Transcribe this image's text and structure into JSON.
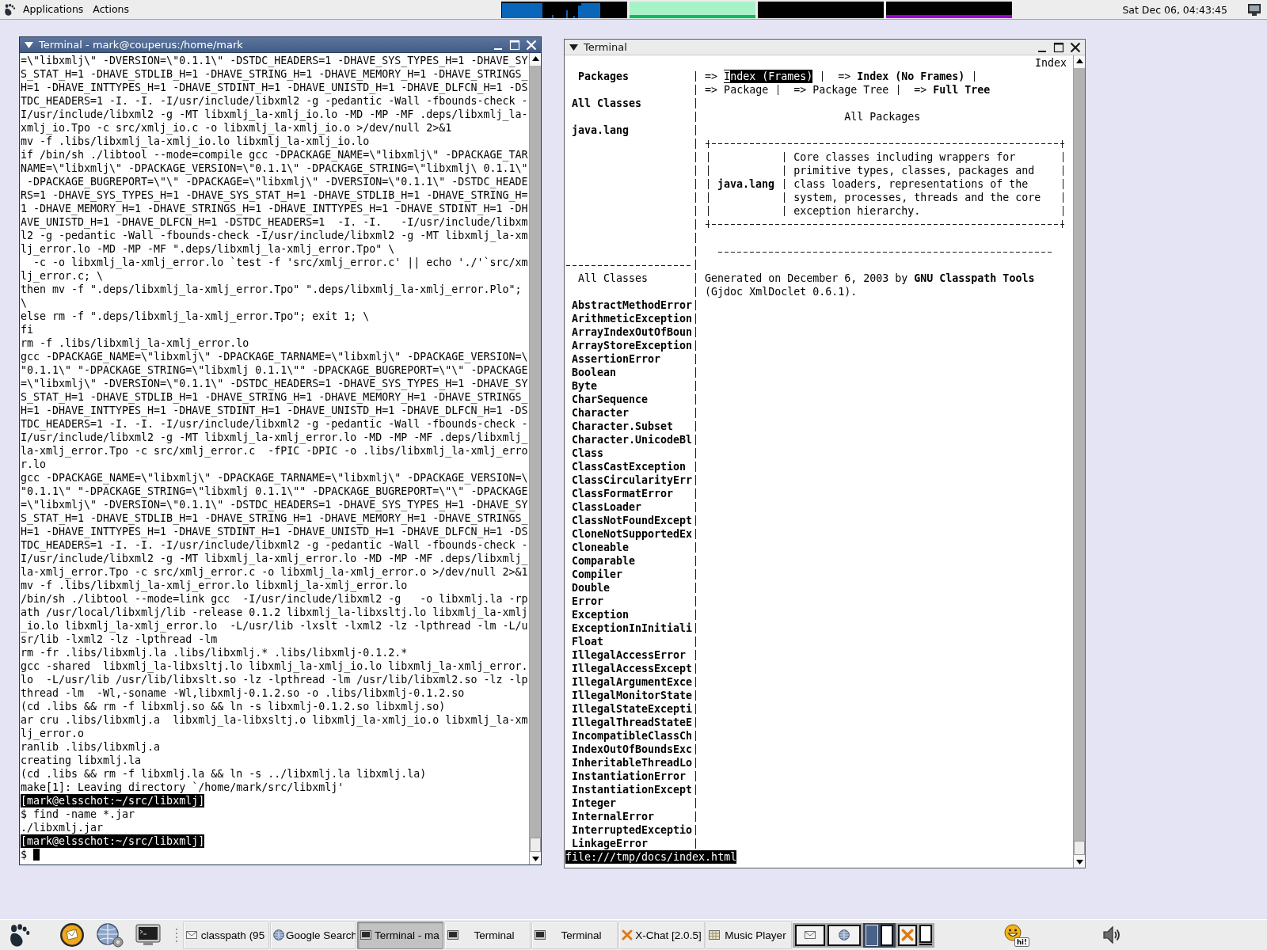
{
  "top_panel": {
    "menus": [
      "Applications",
      "Actions"
    ],
    "clock": "Sat Dec 06, 04:43:45"
  },
  "windows": [
    {
      "kind": "shell",
      "title": "Terminal - mark@couperus:/home/mark",
      "focused": true,
      "lines": [
        {
          "kind": "output",
          "text": "=\\\"libxmlj\\\" -DVERSION=\\\"0.1.1\\\" -DSTDC_HEADERS=1 -DHAVE_SYS_TYPES_H=1 -DHAVE_SY"
        },
        {
          "kind": "output",
          "text": "S_STAT_H=1 -DHAVE_STDLIB_H=1 -DHAVE_STRING_H=1 -DHAVE_MEMORY_H=1 -DHAVE_STRINGS_"
        },
        {
          "kind": "output",
          "text": "H=1 -DHAVE_INTTYPES_H=1 -DHAVE_STDINT_H=1 -DHAVE_UNISTD_H=1 -DHAVE_DLFCN_H=1 -DS"
        },
        {
          "kind": "output",
          "text": "TDC_HEADERS=1 -I. -I. -I/usr/include/libxml2 -g -pedantic -Wall -fbounds-check -"
        },
        {
          "kind": "output",
          "text": "I/usr/include/libxml2 -g -MT libxmlj_la-xmlj_io.lo -MD -MP -MF .deps/libxmlj_la-"
        },
        {
          "kind": "output",
          "text": "xmlj_io.Tpo -c src/xmlj_io.c -o libxmlj_la-xmlj_io.o >/dev/null 2>&1"
        },
        {
          "kind": "output",
          "text": "mv -f .libs/libxmlj_la-xmlj_io.lo libxmlj_la-xmlj_io.lo"
        },
        {
          "kind": "output",
          "text": "if /bin/sh ./libtool --mode=compile gcc -DPACKAGE_NAME=\\\"libxmlj\\\" -DPACKAGE_TAR"
        },
        {
          "kind": "output",
          "text": "NAME=\\\"libxmlj\\\" -DPACKAGE_VERSION=\\\"0.1.1\\\" -DPACKAGE_STRING=\\\"libxmlj\\ 0.1.1\\\""
        },
        {
          "kind": "output",
          "text": " -DPACKAGE_BUGREPORT=\\\"\\\" -DPACKAGE=\\\"libxmlj\\\" -DVERSION=\\\"0.1.1\\\" -DSTDC_HEADE"
        },
        {
          "kind": "output",
          "text": "RS=1 -DHAVE_SYS_TYPES_H=1 -DHAVE_SYS_STAT_H=1 -DHAVE_STDLIB_H=1 -DHAVE_STRING_H="
        },
        {
          "kind": "output",
          "text": "1 -DHAVE_MEMORY_H=1 -DHAVE_STRINGS_H=1 -DHAVE_INTTYPES_H=1 -DHAVE_STDINT_H=1 -DH"
        },
        {
          "kind": "output",
          "text": "AVE_UNISTD_H=1 -DHAVE_DLFCN_H=1 -DSTDC_HEADERS=1  -I. -I.   -I/usr/include/libxm"
        },
        {
          "kind": "output",
          "text": "l2 -g -pedantic -Wall -fbounds-check -I/usr/include/libxml2 -g -MT libxmlj_la-xm"
        },
        {
          "kind": "output",
          "text": "lj_error.lo -MD -MP -MF \".deps/libxmlj_la-xmlj_error.Tpo\" \\"
        },
        {
          "kind": "output",
          "text": "  -c -o libxmlj_la-xmlj_error.lo `test -f 'src/xmlj_error.c' || echo './'`src/xm"
        },
        {
          "kind": "output",
          "text": "lj_error.c; \\"
        },
        {
          "kind": "output",
          "text": "then mv -f \".deps/libxmlj_la-xmlj_error.Tpo\" \".deps/libxmlj_la-xmlj_error.Plo\";"
        },
        {
          "kind": "output",
          "text": "\\"
        },
        {
          "kind": "output",
          "text": "else rm -f \".deps/libxmlj_la-xmlj_error.Tpo\"; exit 1; \\"
        },
        {
          "kind": "output",
          "text": "fi"
        },
        {
          "kind": "output",
          "text": "rm -f .libs/libxmlj_la-xmlj_error.lo"
        },
        {
          "kind": "output",
          "text": "gcc -DPACKAGE_NAME=\\\"libxmlj\\\" -DPACKAGE_TARNAME=\\\"libxmlj\\\" -DPACKAGE_VERSION=\\"
        },
        {
          "kind": "output",
          "text": "\"0.1.1\\\" \"-DPACKAGE_STRING=\\\"libxmlj 0.1.1\\\"\" -DPACKAGE_BUGREPORT=\\\"\\\" -DPACKAGE"
        },
        {
          "kind": "output",
          "text": "=\\\"libxmlj\\\" -DVERSION=\\\"0.1.1\\\" -DSTDC_HEADERS=1 -DHAVE_SYS_TYPES_H=1 -DHAVE_SY"
        },
        {
          "kind": "output",
          "text": "S_STAT_H=1 -DHAVE_STDLIB_H=1 -DHAVE_STRING_H=1 -DHAVE_MEMORY_H=1 -DHAVE_STRINGS_"
        },
        {
          "kind": "output",
          "text": "H=1 -DHAVE_INTTYPES_H=1 -DHAVE_STDINT_H=1 -DHAVE_UNISTD_H=1 -DHAVE_DLFCN_H=1 -DS"
        },
        {
          "kind": "output",
          "text": "TDC_HEADERS=1 -I. -I. -I/usr/include/libxml2 -g -pedantic -Wall -fbounds-check -"
        },
        {
          "kind": "output",
          "text": "I/usr/include/libxml2 -g -MT libxmlj_la-xmlj_error.lo -MD -MP -MF .deps/libxmlj_"
        },
        {
          "kind": "output",
          "text": "la-xmlj_error.Tpo -c src/xmlj_error.c  -fPIC -DPIC -o .libs/libxmlj_la-xmlj_erro"
        },
        {
          "kind": "output",
          "text": "r.lo"
        },
        {
          "kind": "output",
          "text": "gcc -DPACKAGE_NAME=\\\"libxmlj\\\" -DPACKAGE_TARNAME=\\\"libxmlj\\\" -DPACKAGE_VERSION=\\"
        },
        {
          "kind": "output",
          "text": "\"0.1.1\\\" \"-DPACKAGE_STRING=\\\"libxmlj 0.1.1\\\"\" -DPACKAGE_BUGREPORT=\\\"\\\" -DPACKAGE"
        },
        {
          "kind": "output",
          "text": "=\\\"libxmlj\\\" -DVERSION=\\\"0.1.1\\\" -DSTDC_HEADERS=1 -DHAVE_SYS_TYPES_H=1 -DHAVE_SY"
        },
        {
          "kind": "output",
          "text": "S_STAT_H=1 -DHAVE_STDLIB_H=1 -DHAVE_STRING_H=1 -DHAVE_MEMORY_H=1 -DHAVE_STRINGS_"
        },
        {
          "kind": "output",
          "text": "H=1 -DHAVE_INTTYPES_H=1 -DHAVE_STDINT_H=1 -DHAVE_UNISTD_H=1 -DHAVE_DLFCN_H=1 -DS"
        },
        {
          "kind": "output",
          "text": "TDC_HEADERS=1 -I. -I. -I/usr/include/libxml2 -g -pedantic -Wall -fbounds-check -"
        },
        {
          "kind": "output",
          "text": "I/usr/include/libxml2 -g -MT libxmlj_la-xmlj_error.lo -MD -MP -MF .deps/libxmlj_"
        },
        {
          "kind": "output",
          "text": "la-xmlj_error.Tpo -c src/xmlj_error.c -o libxmlj_la-xmlj_error.o >/dev/null 2>&1"
        },
        {
          "kind": "output",
          "text": "mv -f .libs/libxmlj_la-xmlj_error.lo libxmlj_la-xmlj_error.lo"
        },
        {
          "kind": "output",
          "text": "/bin/sh ./libtool --mode=link gcc  -I/usr/include/libxml2 -g   -o libxmlj.la -rp"
        },
        {
          "kind": "output",
          "text": "ath /usr/local/libxmlj/lib -release 0.1.2 libxmlj_la-libxsltj.lo libxmlj_la-xmlj"
        },
        {
          "kind": "output",
          "text": "_io.lo libxmlj_la-xmlj_error.lo  -L/usr/lib -lxslt -lxml2 -lz -lpthread -lm -L/u"
        },
        {
          "kind": "output",
          "text": "sr/lib -lxml2 -lz -lpthread -lm"
        },
        {
          "kind": "output",
          "text": "rm -fr .libs/libxmlj.la .libs/libxmlj.* .libs/libxmlj-0.1.2.*"
        },
        {
          "kind": "output",
          "text": "gcc -shared  libxmlj_la-libxsltj.lo libxmlj_la-xmlj_io.lo libxmlj_la-xmlj_error."
        },
        {
          "kind": "output",
          "text": "lo  -L/usr/lib /usr/lib/libxslt.so -lz -lpthread -lm /usr/lib/libxml2.so -lz -lp"
        },
        {
          "kind": "output",
          "text": "thread -lm  -Wl,-soname -Wl,libxmlj-0.1.2.so -o .libs/libxmlj-0.1.2.so"
        },
        {
          "kind": "output",
          "text": "(cd .libs && rm -f libxmlj.so && ln -s libxmlj-0.1.2.so libxmlj.so)"
        },
        {
          "kind": "output",
          "text": "ar cru .libs/libxmlj.a  libxmlj_la-libxsltj.o libxmlj_la-xmlj_io.o libxmlj_la-xm"
        },
        {
          "kind": "output",
          "text": "lj_error.o"
        },
        {
          "kind": "output",
          "text": "ranlib .libs/libxmlj.a"
        },
        {
          "kind": "output",
          "text": "creating libxmlj.la"
        },
        {
          "kind": "output",
          "text": "(cd .libs && rm -f libxmlj.la && ln -s ../libxmlj.la libxmlj.la)"
        },
        {
          "kind": "output",
          "text": "make[1]: Leaving directory `/home/mark/src/libxmlj'"
        },
        {
          "kind": "prompt",
          "text": "[mark@elsschot:~/src/libxmlj]"
        },
        {
          "kind": "output",
          "text": "$ find -name *.jar"
        },
        {
          "kind": "output",
          "text": "./libxmlj.jar"
        },
        {
          "kind": "prompt",
          "text": "[mark@elsschot:~/src/libxmlj]"
        },
        {
          "kind": "cursor",
          "text": "$"
        }
      ]
    },
    {
      "kind": "browser",
      "title": "Terminal",
      "focused": false,
      "browser": {
        "page_title": "Index",
        "side_frame": {
          "packages_link": "Packages",
          "all_classes_link": "All Classes",
          "package_links": [
            "java.lang"
          ],
          "classes_heading": "All Classes",
          "classes": [
            "AbstractMethodError",
            "ArithmeticException",
            "ArrayIndexOutOfBoun",
            "ArrayStoreException",
            "AssertionError",
            "Boolean",
            "Byte",
            "CharSequence",
            "Character",
            "Character.Subset",
            "Character.UnicodeBl",
            "Class",
            "ClassCastException",
            "ClassCircularityErr",
            "ClassFormatError",
            "ClassLoader",
            "ClassNotFoundExcept",
            "CloneNotSupportedEx",
            "Cloneable",
            "Comparable",
            "Compiler",
            "Double",
            "Error",
            "Exception",
            "ExceptionInInitiali",
            "Float",
            "IllegalAccessError",
            "IllegalAccessExcept",
            "IllegalArgumentExce",
            "IllegalMonitorState",
            "IllegalStateExcepti",
            "IllegalThreadStateE",
            "IncompatibleClassCh",
            "IndexOutOfBoundsExc",
            "InheritableThreadLo",
            "InstantiationError",
            "InstantiationExcept",
            "Integer",
            "InternalError",
            "InterruptedExceptio",
            "LinkageError"
          ]
        },
        "main_frame": {
          "nav": [
            [
              {
                "arrow": "=>",
                "label": "Index (Frames)",
                "link": true,
                "selected": true
              },
              {
                "arrow": "=>",
                "label": "Index (No Frames)",
                "link": true,
                "selected": false
              }
            ],
            [
              {
                "arrow": "=>",
                "label": "Package",
                "link": false,
                "selected": false
              },
              {
                "arrow": "=>",
                "label": "Package Tree",
                "link": false,
                "selected": false
              },
              {
                "arrow": "=>",
                "label": "Full Tree",
                "link": true,
                "selected": false
              }
            ]
          ],
          "heading": "All Packages",
          "packages": [
            {
              "name": "java.lang",
              "description": "Core classes including wrappers for primitive types, classes, packages and class loaders, representations of the system, processes, threads and the core exception hierarchy."
            }
          ],
          "footer": {
            "before": "Generated on December 6, 2003 by",
            "link": "GNU Classpath Tools",
            "after": "(Gjdoc XmlDoclet 0.6.1)."
          }
        },
        "status": "file:///tmp/docs/index.html"
      }
    }
  ],
  "bottom_panel": {
    "tasks": [
      {
        "kind": "mail",
        "label": "classpath (95",
        "selected": false
      },
      {
        "kind": "browser",
        "label": "Google Search",
        "selected": false
      },
      {
        "kind": "terminal",
        "label": "Terminal - ma",
        "selected": true
      },
      {
        "kind": "terminal",
        "label": "Terminal",
        "selected": false
      },
      {
        "kind": "terminal",
        "label": "Terminal",
        "selected": false
      },
      {
        "kind": "chat",
        "label": "X-Chat [2.0.5]",
        "selected": false
      },
      {
        "kind": "player",
        "label": "Music Player",
        "selected": false
      }
    ],
    "workspaces": [
      {
        "selected": true
      },
      {
        "selected": false
      }
    ],
    "chat_bubble": "hi!"
  }
}
